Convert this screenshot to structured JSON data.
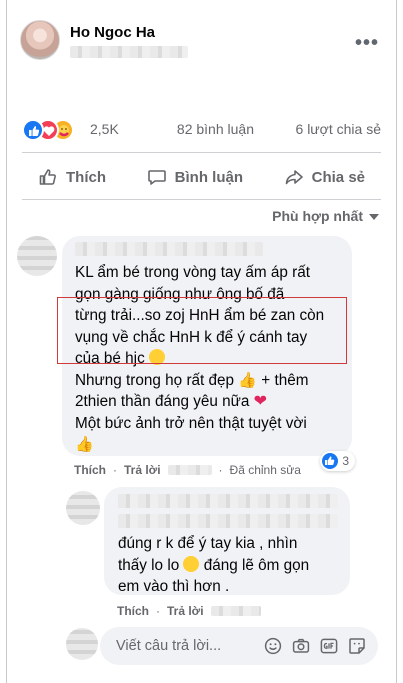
{
  "post": {
    "author": "Ho Ngoc Ha",
    "more_label": "•••"
  },
  "stats": {
    "reactions_count": "2,5K",
    "comments_count": "82 bình luận",
    "shares_count": "6 lượt chia sẻ",
    "reaction_icons": [
      "like-icon",
      "love-icon",
      "care-icon"
    ]
  },
  "actions": {
    "like": "Thích",
    "comment": "Bình luận",
    "share": "Chia sẻ"
  },
  "sort": {
    "label": "Phù hợp nhất"
  },
  "comment1": {
    "lines": [
      "KL ẩm bé trong vòng tay ấm áp rất",
      "gọn gàng giống như ông bố đã",
      "từng trải...so zoj HnH ẩm bé zan còn",
      "vụng về chắc HnH k để ý cánh tay",
      "của bé hjc",
      "Nhưng trong họ rất đẹp",
      "+ thêm",
      "2thien thần đáng yêu nữa",
      "Một bức ảnh trở nên thật tuyệt vời"
    ],
    "like_label": "Thích",
    "reply_label": "Trả lời",
    "edited_label": "Đã chỉnh sửa",
    "reaction_count": "3"
  },
  "comment2": {
    "lines": [
      "đúng r k để ý tay kia , nhìn",
      "thấy lo lo",
      "đáng lẽ ôm gọn",
      "em vào thì hơn ."
    ],
    "like_label": "Thích",
    "reply_label": "Trả lời"
  },
  "reply_box": {
    "placeholder": "Viết câu trả lời..."
  },
  "colors": {
    "accent": "#1877f2",
    "love": "#f33e58",
    "highlight_border": "#d13a3a",
    "bubble": "#f0f2f5"
  }
}
